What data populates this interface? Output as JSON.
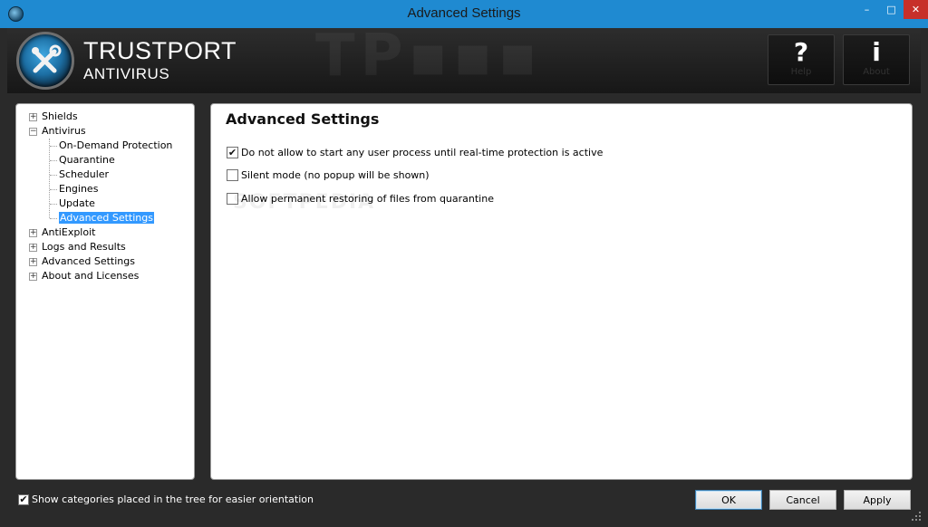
{
  "window": {
    "title": "Advanced Settings",
    "controls": {
      "minimize": "–",
      "maximize": "□",
      "close": "✕"
    }
  },
  "header": {
    "brand_name": "TRUSTPORT",
    "brand_sub": "ANTIVIRUS",
    "help_glyph": "?",
    "about_glyph": "i",
    "help_label": "Help",
    "about_label": "About"
  },
  "tree": {
    "items": [
      {
        "label": "Shields",
        "level": 0,
        "expander": "+"
      },
      {
        "label": "Antivirus",
        "level": 0,
        "expander": "−"
      },
      {
        "label": "On-Demand Protection",
        "level": 1
      },
      {
        "label": "Quarantine",
        "level": 1
      },
      {
        "label": "Scheduler",
        "level": 1
      },
      {
        "label": "Engines",
        "level": 1
      },
      {
        "label": "Update",
        "level": 1
      },
      {
        "label": "Advanced Settings",
        "level": 1,
        "selected": true
      },
      {
        "label": "AntiExploit",
        "level": 0,
        "expander": "+"
      },
      {
        "label": "Logs and Results",
        "level": 0,
        "expander": "+"
      },
      {
        "label": "Advanced Settings",
        "level": 0,
        "expander": "+"
      },
      {
        "label": "About and Licenses",
        "level": 0,
        "expander": "+"
      }
    ]
  },
  "content": {
    "title": "Advanced Settings",
    "watermark": "SOFTPEDIA",
    "options": [
      {
        "label": "Do not allow to start any user process until real-time protection is active",
        "checked": true
      },
      {
        "label": "Silent mode (no popup will be shown)",
        "checked": false
      },
      {
        "label": "Allow permanent restoring of files from quarantine",
        "checked": false
      }
    ]
  },
  "footer": {
    "show_categories_label": "Show categories placed in the tree for easier orientation",
    "show_categories_checked": true,
    "ok_label": "OK",
    "cancel_label": "Cancel",
    "apply_label": "Apply"
  },
  "colors": {
    "titlebar": "#1f8ad1",
    "close": "#c7302a",
    "selection": "#3399ff",
    "background": "#2a2a2a"
  }
}
